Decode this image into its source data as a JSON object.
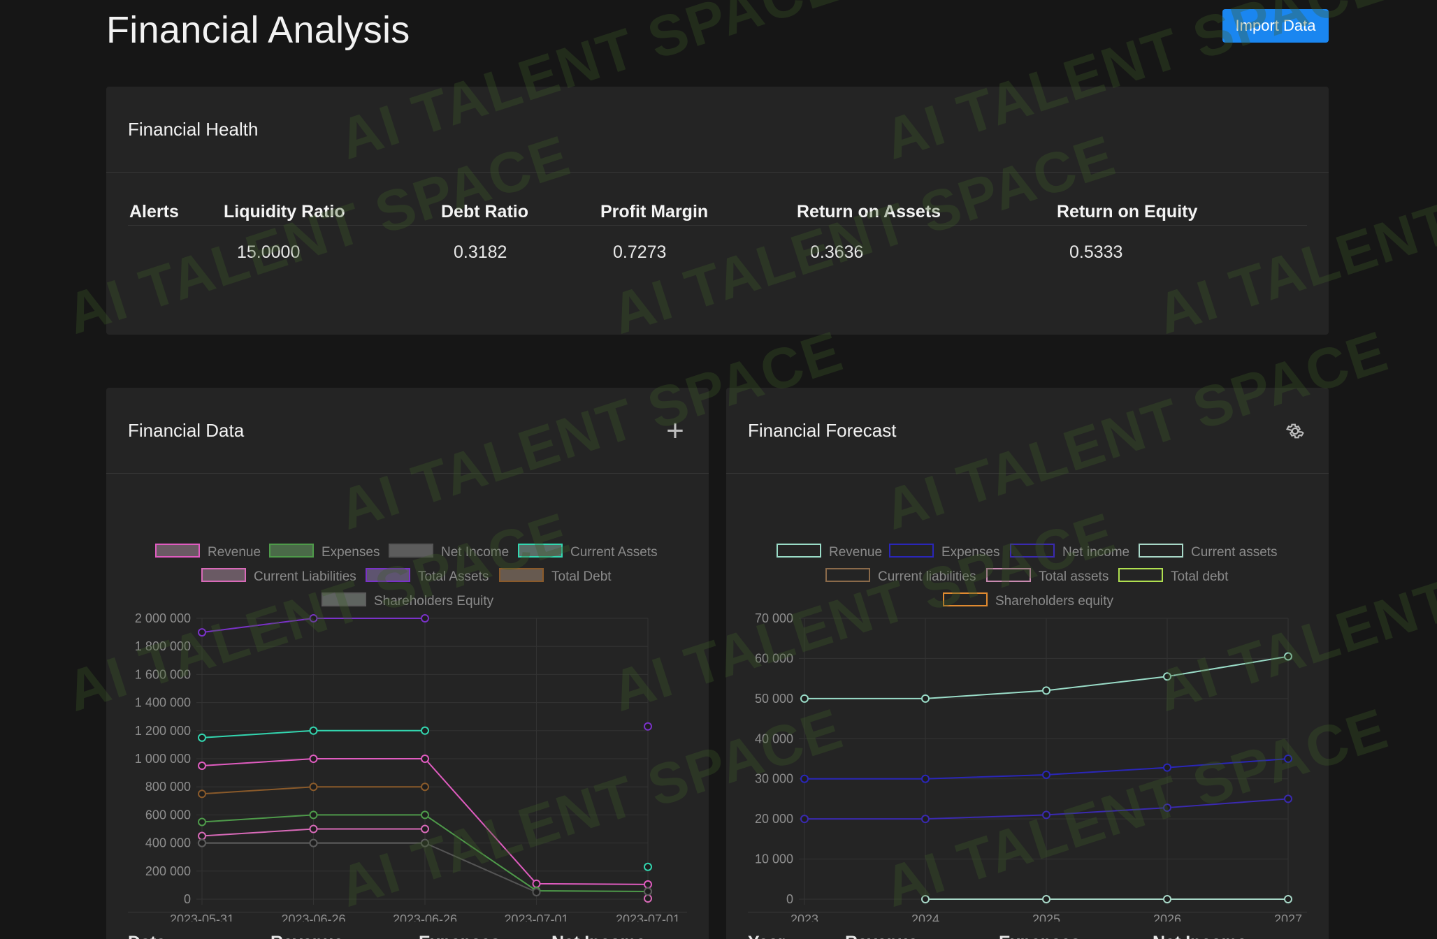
{
  "header": {
    "title": "Financial Analysis",
    "import_label": "Import Data"
  },
  "health": {
    "title": "Financial Health",
    "columns": [
      "Alerts",
      "Liquidity Ratio",
      "Debt Ratio",
      "Profit Margin",
      "Return on Assets",
      "Return on Equity"
    ],
    "values": [
      "",
      "15.0000",
      "0.3182",
      "0.7273",
      "0.3636",
      "0.5333"
    ]
  },
  "data_card": {
    "title": "Financial Data",
    "table_headers": [
      "Date",
      "Revenue",
      "Expenses",
      "Net Income"
    ]
  },
  "forecast_card": {
    "title": "Financial Forecast",
    "table_headers": [
      "Year",
      "Revenue",
      "Expenses",
      "Net Income"
    ]
  },
  "watermark": "AI TALENT SPACE",
  "chart_data": [
    {
      "type": "line",
      "categories": [
        "2023-05-31",
        "2023-06-26",
        "2023-06-26",
        "2023-07-01",
        "2023-07-01"
      ],
      "ylim": [
        0,
        2000000
      ],
      "yticks": [
        "0",
        "200 000",
        "400 000",
        "600 000",
        "800 000",
        "1 000 000",
        "1 200 000",
        "1 400 000",
        "1 600 000",
        "1 800 000",
        "2 000 000"
      ],
      "legend_position": "top",
      "grid": true,
      "series": [
        {
          "name": "Revenue",
          "color": "#e05cc0",
          "fill": "#6a5a64",
          "values": [
            950000,
            1000000,
            1000000,
            110000,
            105000
          ]
        },
        {
          "name": "Expenses",
          "color": "#4e9a4a",
          "fill": "#4a6a48",
          "values": [
            550000,
            600000,
            600000,
            60000,
            55000
          ]
        },
        {
          "name": "Net Income",
          "color": "#555555",
          "fill": "#5c5c5c",
          "values": [
            400000,
            400000,
            400000,
            50000,
            null
          ]
        },
        {
          "name": "Current Assets",
          "color": "#33d6b0",
          "fill": "#5a6e68",
          "values": [
            1150000,
            1200000,
            1200000,
            null,
            230000
          ]
        },
        {
          "name": "Current Liabilities",
          "color": "#d86ab8",
          "fill": "#6a5a64",
          "values": [
            450000,
            500000,
            500000,
            null,
            5000
          ]
        },
        {
          "name": "Total Assets",
          "color": "#7a32c8",
          "fill": "#5e5470",
          "values": [
            1900000,
            2000000,
            2000000,
            null,
            1230000
          ]
        },
        {
          "name": "Total Debt",
          "color": "#8a5a2a",
          "fill": "#675a50",
          "values": [
            750000,
            800000,
            800000,
            null,
            null
          ]
        },
        {
          "name": "Shareholders Equity",
          "color": "#5c5c5c",
          "fill": "#5f6460",
          "values": [
            400000,
            400000,
            400000,
            null,
            55000
          ]
        }
      ]
    },
    {
      "type": "line",
      "categories": [
        "2023",
        "2024",
        "2025",
        "2026",
        "2027"
      ],
      "ylim": [
        0,
        70000
      ],
      "yticks": [
        "0",
        "10 000",
        "20 000",
        "30 000",
        "40 000",
        "50 000",
        "60 000",
        "70 000"
      ],
      "legend_position": "top",
      "grid": true,
      "series": [
        {
          "name": "Revenue",
          "color": "#9adcc8",
          "values": [
            50000,
            50000,
            52000,
            55500,
            60500
          ]
        },
        {
          "name": "Expenses",
          "color": "#2a26b8",
          "values": [
            30000,
            30000,
            31000,
            32800,
            35000
          ]
        },
        {
          "name": "Net income",
          "color": "#3a2ab0",
          "values": [
            20000,
            20000,
            21000,
            22800,
            25000
          ]
        },
        {
          "name": "Current assets",
          "color": "#a8d8c8",
          "values": [
            null,
            0,
            0,
            0,
            0
          ]
        },
        {
          "name": "Current liabilities",
          "color": "#8a6a4a",
          "values": []
        },
        {
          "name": "Total assets",
          "color": "#c88ab0",
          "values": []
        },
        {
          "name": "Total debt",
          "color": "#b0e050",
          "values": []
        },
        {
          "name": "Shareholders equity",
          "color": "#e08a30",
          "values": []
        }
      ]
    }
  ]
}
